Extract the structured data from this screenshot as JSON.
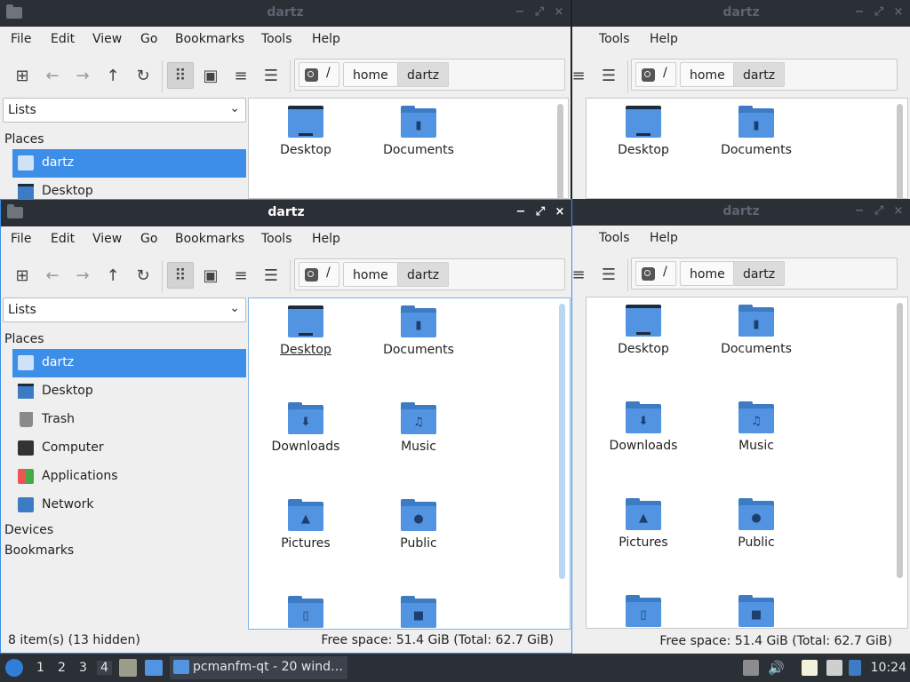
{
  "window_title": "dartz",
  "window_buttons": {
    "minimize": "−",
    "maximize": "⤢",
    "close": "×"
  },
  "menus": [
    "File",
    "Edit",
    "View",
    "Go",
    "Bookmarks",
    "Tools",
    "Help"
  ],
  "breadcrumbs": {
    "root": "/",
    "items": [
      "home",
      "dartz"
    ]
  },
  "sidebar": {
    "view_mode": "Lists",
    "places_heading": "Places",
    "places": [
      {
        "label": "dartz",
        "icon": "home-folder-icon",
        "selected": true
      },
      {
        "label": "Desktop",
        "icon": "desktop-icon"
      },
      {
        "label": "Trash",
        "icon": "trash-icon"
      },
      {
        "label": "Computer",
        "icon": "computer-icon"
      },
      {
        "label": "Applications",
        "icon": "applications-icon"
      },
      {
        "label": "Network",
        "icon": "network-icon"
      }
    ],
    "devices_heading": "Devices",
    "bookmarks_heading": "Bookmarks"
  },
  "files": [
    {
      "name": "Desktop",
      "icon": "desktop-folder-icon",
      "selected": true
    },
    {
      "name": "Documents",
      "icon": "documents-folder-icon"
    },
    {
      "name": "Downloads",
      "icon": "downloads-folder-icon"
    },
    {
      "name": "Music",
      "icon": "music-folder-icon"
    },
    {
      "name": "Pictures",
      "icon": "pictures-folder-icon"
    },
    {
      "name": "Public",
      "icon": "public-folder-icon"
    },
    {
      "name": "",
      "icon": "templates-folder-icon"
    },
    {
      "name": "",
      "icon": "videos-folder-icon"
    }
  ],
  "status": {
    "items": "8 item(s) (13 hidden)",
    "free": "Free space: 51.4 GiB (Total: 62.7 GiB)"
  },
  "taskbar": {
    "workspaces": [
      "1",
      "2",
      "3",
      "4"
    ],
    "current_workspace": "4",
    "task_label": "pcmanfm-qt - 20 wind…",
    "clock": "10:24"
  },
  "colors": {
    "accent": "#3d8ee8",
    "folder": "#5294e2",
    "panel": "#2b2f36"
  }
}
